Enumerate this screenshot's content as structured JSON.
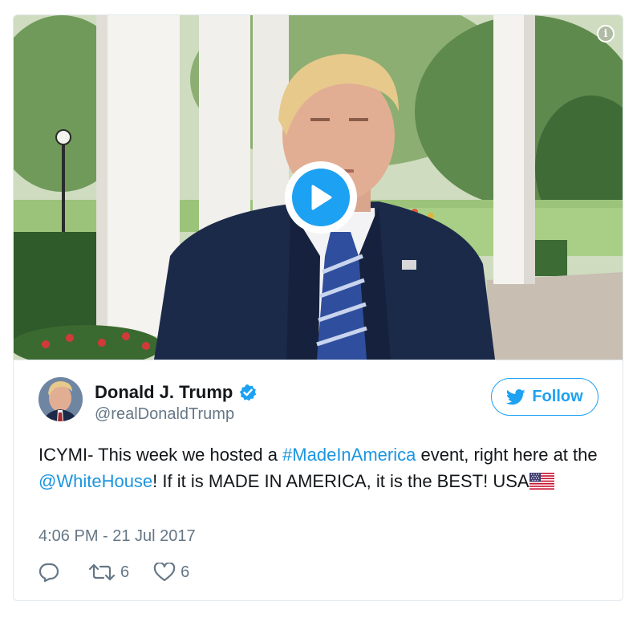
{
  "media": {
    "play_icon": "play-icon",
    "info_icon": "info-icon",
    "info_label": "i"
  },
  "author": {
    "name": "Donald J. Trump",
    "handle": "@realDonaldTrump",
    "verified": true,
    "verified_icon": "verified-badge-icon"
  },
  "follow": {
    "label": "Follow",
    "icon": "twitter-bird-icon"
  },
  "tweet": {
    "text_part1": "ICYMI- This week we hosted a ",
    "hashtag": "#MadeInAmerica",
    "text_part2": " event, right here at the ",
    "mention": "@WhiteHouse",
    "text_part3": "! If it is MADE IN AMERICA, it is the BEST! USA",
    "emoji_icon": "us-flag-icon"
  },
  "timestamp": "4:06 PM - 21 Jul 2017",
  "actions": {
    "reply_icon": "reply-icon",
    "retweet_icon": "retweet-icon",
    "retweet_count": "6",
    "like_icon": "heart-icon",
    "like_count": "6"
  },
  "colors": {
    "accent": "#1da1f2",
    "link": "#1b95e0",
    "secondary_text": "#657786",
    "border": "#e1e8ed"
  }
}
